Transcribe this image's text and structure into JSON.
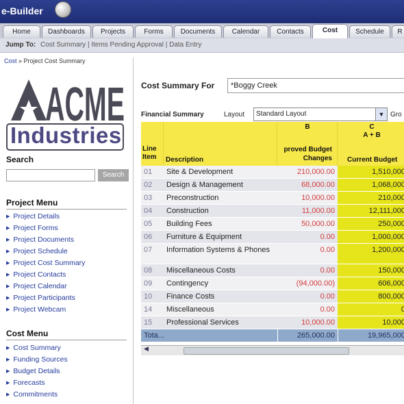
{
  "app": {
    "logo_text": "e-Builder"
  },
  "tabs": [
    {
      "label": "Home"
    },
    {
      "label": "Dashboards"
    },
    {
      "label": "Projects"
    },
    {
      "label": "Forms"
    },
    {
      "label": "Documents"
    },
    {
      "label": "Calendar"
    },
    {
      "label": "Contacts"
    },
    {
      "label": "Cost"
    },
    {
      "label": "Schedule"
    },
    {
      "label": "R"
    }
  ],
  "jump_bar": {
    "label": "Jump To:",
    "links": "Cost Summary  |  Items Pending Approval  |  Data Entry"
  },
  "breadcrumb": {
    "root": "Cost",
    "sep": " » ",
    "current": "Project Cost Summary"
  },
  "company": {
    "name_top": "ACME",
    "name_bottom": "Industries"
  },
  "search": {
    "heading": "Search",
    "button": "Search",
    "placeholder": ""
  },
  "project_menu": {
    "heading": "Project Menu",
    "items": [
      "Project Details",
      "Project Forms",
      "Project Documents",
      "Project Schedule",
      "Project Cost Summary",
      "Project Contacts",
      "Project Calendar",
      "Project Participants",
      "Project Webcam"
    ]
  },
  "cost_menu": {
    "heading": "Cost Menu",
    "items": [
      "Cost Summary",
      "Funding Sources",
      "Budget Details",
      "Forecasts",
      "Commitments"
    ]
  },
  "summary": {
    "label": "Cost Summary For",
    "project": "*Boggy Creek"
  },
  "financial": {
    "label": "Financial Summary",
    "layout_label": "Layout",
    "layout_value": "Standard Layout",
    "group_label": "Gro"
  },
  "table": {
    "headers": {
      "line_item": "Line Item",
      "description": "Description",
      "col_b_letter": "B",
      "col_b": "proved Budget Changes",
      "col_c_letter": "C",
      "col_c_formula": "A + B",
      "col_c": "Current Budget"
    },
    "rows": [
      {
        "line": "01",
        "desc": "Site & Development",
        "b": "210,000.00",
        "c": "1,510,000"
      },
      {
        "line": "02",
        "desc": "Design & Management",
        "b": "68,000.00",
        "c": "1,068,000"
      },
      {
        "line": "03",
        "desc": "Preconstruction",
        "b": "10,000.00",
        "c": "210,000"
      },
      {
        "line": "04",
        "desc": "Construction",
        "b": "11,000.00",
        "c": "12,111,000"
      },
      {
        "line": "05",
        "desc": "Building Fees",
        "b": "50,000.00",
        "c": "250,000"
      },
      {
        "line": "06",
        "desc": "Furniture & Equipment",
        "b": "0.00",
        "c": "1,000,000"
      },
      {
        "line": "07",
        "desc": "Information Systems & Phones",
        "b": "0.00",
        "c": "1,200,000"
      },
      {
        "line": "08",
        "desc": "Miscellaneous Costs",
        "b": "0.00",
        "c": "150,000"
      },
      {
        "line": "09",
        "desc": "Contingency",
        "b": "(94,000.00)",
        "c": "606,000"
      },
      {
        "line": "10",
        "desc": "Finance Costs",
        "b": "0.00",
        "c": "800,000"
      },
      {
        "line": "14",
        "desc": "Miscellaneous",
        "b": "0.00",
        "c": "0"
      },
      {
        "line": "15",
        "desc": "Professional Services",
        "b": "10,000.00",
        "c": "10,000"
      }
    ],
    "total": {
      "label": "Tota...",
      "b": "265,000.00",
      "c": "19,965,000"
    }
  },
  "colors": {
    "header_yellow": "#f7e84a",
    "current_budget": "#e6e51c",
    "navy": "#1e2d74",
    "link_blue": "#233b9c",
    "negative_red": "#d23a3a"
  }
}
